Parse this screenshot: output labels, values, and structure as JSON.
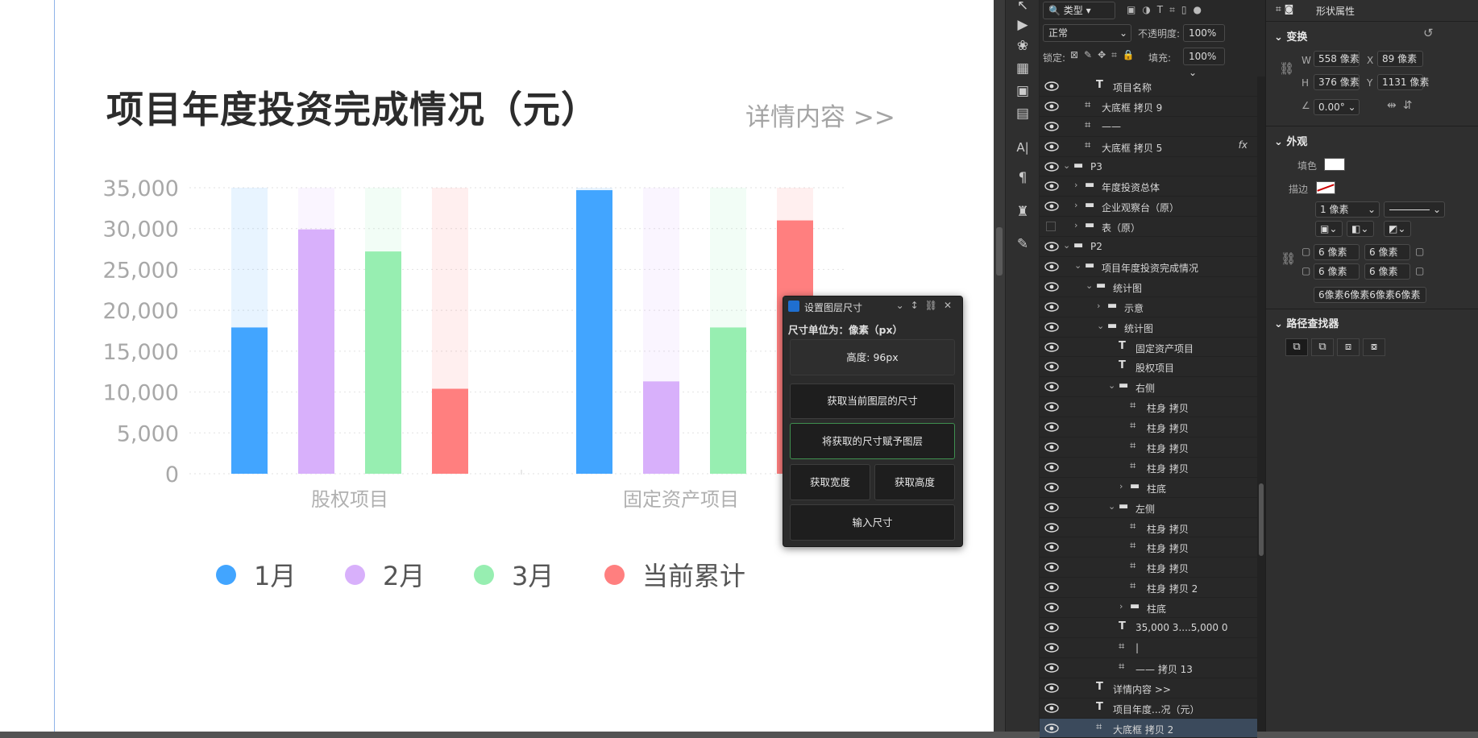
{
  "canvas": {
    "title": "项目年度投资完成情况（元）",
    "detail_link": "详情内容 >>"
  },
  "chart_data": {
    "type": "bar",
    "title": "项目年度投资完成情况（元）",
    "categories": [
      "股权项目",
      "固定资产项目"
    ],
    "ylim": [
      0,
      35000
    ],
    "yticks": [
      "35,000",
      "30,000",
      "25,000",
      "20,000",
      "15,000",
      "10,000",
      "5,000",
      "0"
    ],
    "grid": true,
    "legend_position": "bottom",
    "max_value": 35000,
    "series": [
      {
        "name": "1月",
        "color": "#42a5ff",
        "values": [
          17900,
          34700
        ]
      },
      {
        "name": "2月",
        "color": "#d8b0fb",
        "values": [
          29900,
          11300
        ]
      },
      {
        "name": "3月",
        "color": "#97eeb1",
        "values": [
          27200,
          17900
        ]
      },
      {
        "name": "当前累计",
        "color": "#ff7f7f",
        "values": [
          10400,
          31000
        ]
      }
    ]
  },
  "dialog": {
    "title": "设置图层尺寸",
    "unit_label": "尺寸单位为：像素（px）",
    "height_display": "高度: 96px",
    "btn_get_size": "获取当前图层的尺寸",
    "btn_apply_size": "将获取的尺寸赋予图层",
    "btn_get_width": "获取宽度",
    "btn_get_height": "获取高度",
    "btn_input_size": "输入尺寸"
  },
  "layers_toolbar": {
    "filter_kind": "类型",
    "blend_mode": "正常",
    "opacity_label": "不透明度:",
    "opacity_value": "100%",
    "lock_label": "锁定:",
    "fill_label": "填充:",
    "fill_value": "100%"
  },
  "layers": [
    {
      "name": "项目名称",
      "indent": 5,
      "icon": "text-icon",
      "arrow": "",
      "fx": ""
    },
    {
      "name": "大底框 拷贝 9",
      "indent": 4,
      "icon": "shape-icon",
      "arrow": "",
      "fx": ""
    },
    {
      "name": "——",
      "indent": 4,
      "icon": "shape-icon",
      "arrow": "",
      "fx": ""
    },
    {
      "name": "大底框 拷贝 5",
      "indent": 4,
      "icon": "shape-icon",
      "arrow": "",
      "fx": "fx"
    },
    {
      "name": "P3",
      "indent": 3,
      "icon": "folder-icon",
      "arrow": "v",
      "fx": ""
    },
    {
      "name": "年度投资总体",
      "indent": 4,
      "icon": "folder-icon",
      "arrow": ">",
      "fx": ""
    },
    {
      "name": "企业观察台（原）",
      "indent": 4,
      "icon": "folder-icon",
      "arrow": ">",
      "fx": ""
    },
    {
      "name": "表（原）",
      "indent": 4,
      "icon": "folder-icon",
      "arrow": ">",
      "fx": "",
      "hidden": true
    },
    {
      "name": "P2",
      "indent": 3,
      "icon": "folder-icon",
      "arrow": "v",
      "fx": ""
    },
    {
      "name": "项目年度投资完成情况",
      "indent": 4,
      "icon": "folder-icon",
      "arrow": "v",
      "fx": ""
    },
    {
      "name": "统计图",
      "indent": 5,
      "icon": "folder-icon",
      "arrow": "v",
      "fx": ""
    },
    {
      "name": "示意",
      "indent": 6,
      "icon": "folder-icon",
      "arrow": ">",
      "fx": ""
    },
    {
      "name": "统计图",
      "indent": 6,
      "icon": "folder-icon",
      "arrow": "v",
      "fx": ""
    },
    {
      "name": "固定资产项目",
      "indent": 7,
      "icon": "text-icon",
      "arrow": "",
      "fx": ""
    },
    {
      "name": "股权项目",
      "indent": 7,
      "icon": "text-icon",
      "arrow": "",
      "fx": ""
    },
    {
      "name": "右侧",
      "indent": 7,
      "icon": "folder-icon",
      "arrow": "v",
      "fx": ""
    },
    {
      "name": "柱身 拷贝",
      "indent": 8,
      "icon": "shape-icon",
      "arrow": "",
      "fx": ""
    },
    {
      "name": "柱身 拷贝",
      "indent": 8,
      "icon": "shape-icon",
      "arrow": "",
      "fx": ""
    },
    {
      "name": "柱身 拷贝",
      "indent": 8,
      "icon": "shape-icon",
      "arrow": "",
      "fx": ""
    },
    {
      "name": "柱身 拷贝",
      "indent": 8,
      "icon": "shape-icon",
      "arrow": "",
      "fx": ""
    },
    {
      "name": "柱底",
      "indent": 8,
      "icon": "folder-icon",
      "arrow": ">",
      "fx": ""
    },
    {
      "name": "左侧",
      "indent": 7,
      "icon": "folder-icon",
      "arrow": "v",
      "fx": ""
    },
    {
      "name": "柱身 拷贝",
      "indent": 8,
      "icon": "shape-icon",
      "arrow": "",
      "fx": ""
    },
    {
      "name": "柱身 拷贝",
      "indent": 8,
      "icon": "shape-icon",
      "arrow": "",
      "fx": ""
    },
    {
      "name": "柱身 拷贝",
      "indent": 8,
      "icon": "shape-icon",
      "arrow": "",
      "fx": ""
    },
    {
      "name": "柱身 拷贝 2",
      "indent": 8,
      "icon": "shape-icon",
      "arrow": "",
      "fx": ""
    },
    {
      "name": "柱底",
      "indent": 8,
      "icon": "folder-icon",
      "arrow": ">",
      "fx": ""
    },
    {
      "name": "35,000 3....5,000 0",
      "indent": 7,
      "icon": "text-icon",
      "arrow": "",
      "fx": ""
    },
    {
      "name": "|",
      "indent": 7,
      "icon": "shape-icon",
      "arrow": "",
      "fx": ""
    },
    {
      "name": "—— 拷贝 13",
      "indent": 7,
      "icon": "shape-icon",
      "arrow": "",
      "fx": ""
    },
    {
      "name": "详情内容 >>",
      "indent": 5,
      "icon": "text-icon",
      "arrow": "",
      "fx": ""
    },
    {
      "name": "项目年度...况（元）",
      "indent": 5,
      "icon": "text-icon",
      "arrow": "",
      "fx": ""
    },
    {
      "name": "大底框 拷贝 2",
      "indent": 5,
      "icon": "shape-icon",
      "arrow": "",
      "fx": "",
      "selected": true
    }
  ],
  "props": {
    "header_label": "形状属性",
    "transform_title": "变换",
    "w_label": "W",
    "w_value": "558 像素",
    "x_label": "X",
    "x_value": "89 像素",
    "h_label": "H",
    "h_value": "376 像素",
    "y_label": "Y",
    "y_value": "1131 像素",
    "angle_value": "0.00°",
    "appearance_title": "外观",
    "fill_label": "填色",
    "stroke_label": "描边",
    "stroke_width": "1 像素",
    "corner_tl": "6 像素",
    "corner_tr": "6 像素",
    "corner_bl": "6 像素",
    "corner_br": "6 像素",
    "corner_all": "6像素6像素6像素6像素",
    "pathfinder_title": "路径查找器"
  }
}
